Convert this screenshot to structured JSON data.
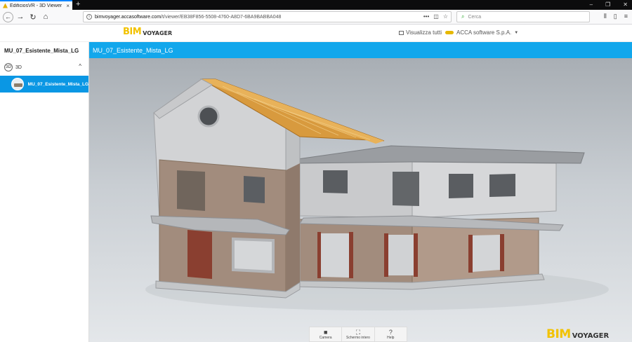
{
  "browser": {
    "tab_title": "EdificiosVR - 3D Viewer",
    "tab_close": "×",
    "new_tab": "+",
    "url_domain": "bimvoyager.accasoftware.com",
    "url_path": "/t/viewer/EB38F856-5508-4760-A8D7-6BA9BABBA048",
    "url_prefix": "",
    "search_placeholder": "Cerca",
    "win_min": "–",
    "win_max": "❐",
    "win_close": "✕"
  },
  "header": {
    "logo_bim": "BIM",
    "logo_voyager": "VOYAGER",
    "view_all": "Visualizza tutti",
    "account": "ACCA software S.p.A."
  },
  "sidebar": {
    "title": "MU_07_Esistente_Mista_LG",
    "section_3d": "3D",
    "model_item": "MU_07_Esistente_Mista_LG"
  },
  "viewer": {
    "title": "MU_07_Esistente_Mista_LG"
  },
  "toolbar": {
    "camera": "Camera",
    "fullscreen": "Schermo intero",
    "help": "Help"
  },
  "colors": {
    "accent": "#12a7ec",
    "selected": "#0a97e4",
    "logo_yellow": "#f2c200"
  }
}
